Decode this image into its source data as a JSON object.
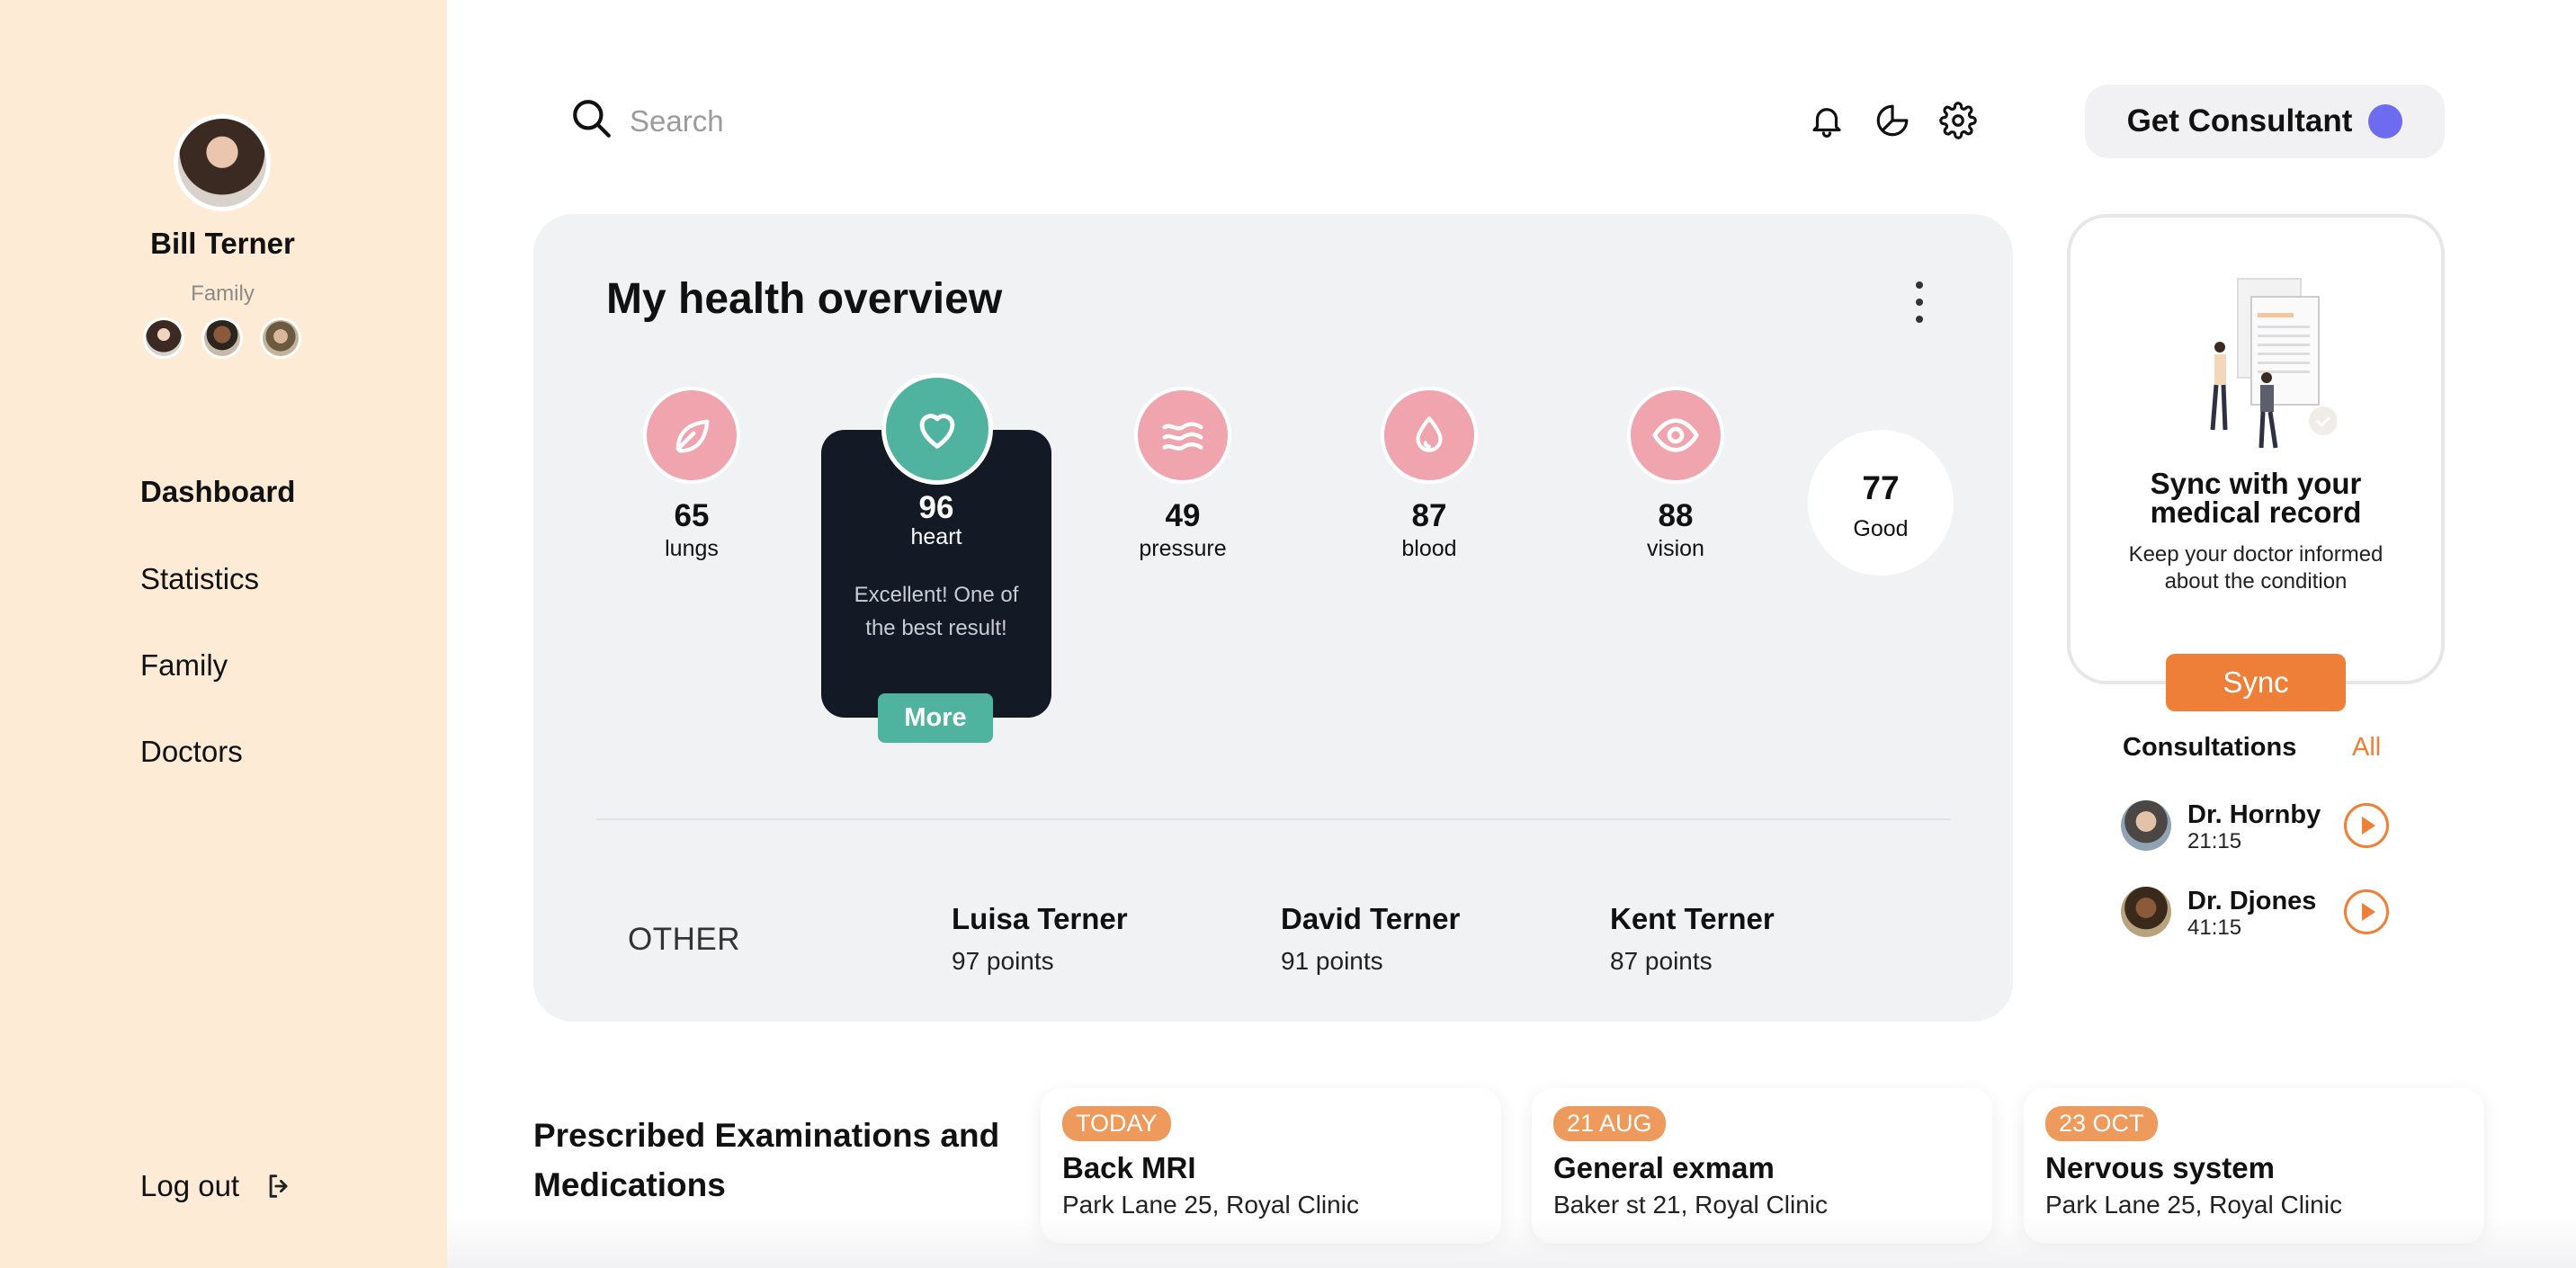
{
  "user": {
    "name": "Bill Terner",
    "family_label": "Family"
  },
  "nav": {
    "items": [
      {
        "label": "Dashboard",
        "active": true
      },
      {
        "label": "Statistics",
        "active": false
      },
      {
        "label": "Family",
        "active": false
      },
      {
        "label": "Doctors",
        "active": false
      }
    ],
    "logout_label": "Log out"
  },
  "search": {
    "placeholder": "Search"
  },
  "header": {
    "consult_button": "Get Consultant"
  },
  "overview": {
    "title": "My health overview",
    "metrics": [
      {
        "value": "65",
        "label": "lungs",
        "icon": "leaf-icon"
      },
      {
        "value": "96",
        "label": "heart",
        "icon": "heart-icon"
      },
      {
        "value": "49",
        "label": "pressure",
        "icon": "waves-icon"
      },
      {
        "value": "87",
        "label": "blood",
        "icon": "drop-icon"
      },
      {
        "value": "88",
        "label": "vision",
        "icon": "eye-icon"
      }
    ],
    "heart_description": "Excellent! One of the best result!",
    "more_label": "More",
    "score": {
      "value": "77",
      "label": "Good"
    },
    "other_label": "OTHER",
    "members": [
      {
        "name": "Luisa Terner",
        "points": "97 points"
      },
      {
        "name": "David Terner",
        "points": "91 points"
      },
      {
        "name": "Kent Terner",
        "points": "87 points"
      }
    ]
  },
  "sync": {
    "title_line1": "Sync with your",
    "title_line2": "medical record",
    "subtitle_line1": "Keep your doctor informed",
    "subtitle_line2": "about the condition",
    "button": "Sync"
  },
  "consultations": {
    "title": "Consultations",
    "all_label": "All",
    "items": [
      {
        "doctor": "Dr. Hornby",
        "time": "21:15"
      },
      {
        "doctor": "Dr. Djones",
        "time": "41:15"
      }
    ]
  },
  "prescribed": {
    "title": "Prescribed Examinations and Medications",
    "items": [
      {
        "badge": "TODAY",
        "title": "Back MRI",
        "location": "Park Lane 25, Royal Clinic"
      },
      {
        "badge": "21 AUG",
        "title": "General exmam",
        "location": "Baker st 21, Royal Clinic"
      },
      {
        "badge": "23 OCT",
        "title": "Nervous system",
        "location": "Park Lane 25, Royal Clinic"
      }
    ]
  },
  "colors": {
    "sidebar": "#fdebd6",
    "accent_orange": "#ed7f38",
    "teal": "#4fb3a0",
    "pink": "#f0a4ad",
    "dark_card": "#141926",
    "consult_dot": "#6d6cf0"
  }
}
